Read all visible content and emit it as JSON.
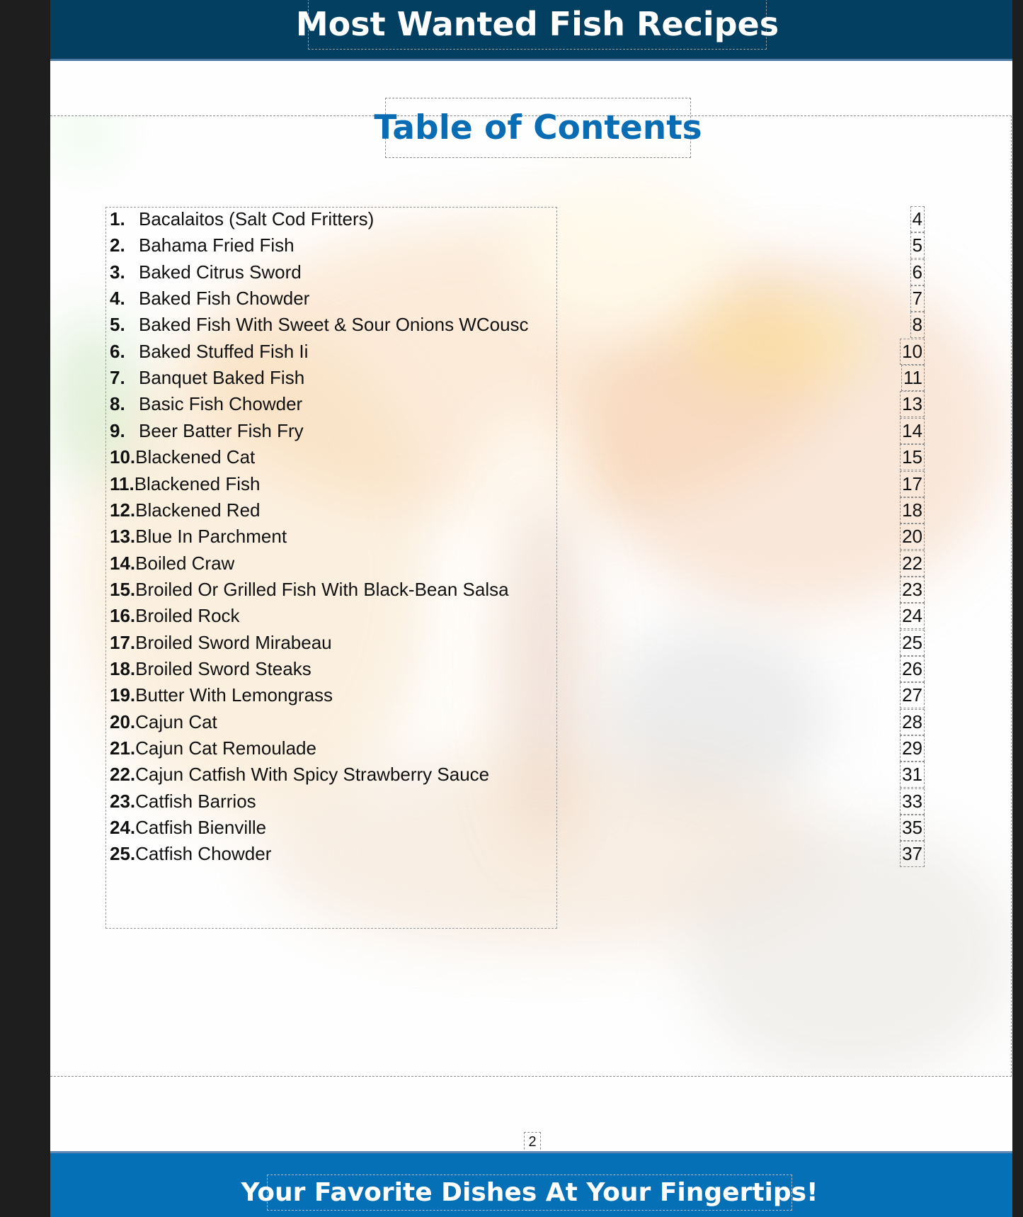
{
  "header": {
    "title": "Most Wanted Fish Recipes"
  },
  "toc": {
    "title": "Table of Contents",
    "entries": [
      {
        "number": "1.",
        "title": "Bacalaitos (Salt Cod Fritters)",
        "page": "4"
      },
      {
        "number": "2.",
        "title": "Bahama Fried Fish",
        "page": "5"
      },
      {
        "number": "3.",
        "title": "Baked Citrus Sword",
        "page": "6"
      },
      {
        "number": "4.",
        "title": "Baked Fish Chowder",
        "page": "7"
      },
      {
        "number": "5.",
        "title": "Baked Fish With Sweet & Sour Onions WCousc",
        "page": "8"
      },
      {
        "number": "6.",
        "title": "Baked Stuffed Fish Ii",
        "page": "10"
      },
      {
        "number": "7.",
        "title": "Banquet Baked Fish",
        "page": "11"
      },
      {
        "number": "8.",
        "title": "Basic Fish Chowder",
        "page": "13"
      },
      {
        "number": "9.",
        "title": "Beer Batter Fish Fry",
        "page": "14"
      },
      {
        "number": "10.",
        "title": "Blackened Cat",
        "page": "15"
      },
      {
        "number": "11.",
        "title": "Blackened Fish",
        "page": "17"
      },
      {
        "number": "12.",
        "title": "Blackened Red",
        "page": "18"
      },
      {
        "number": "13.",
        "title": "Blue In Parchment",
        "page": "20"
      },
      {
        "number": "14.",
        "title": "Boiled Craw",
        "page": "22"
      },
      {
        "number": "15.",
        "title": "Broiled Or Grilled Fish With Black-Bean Salsa",
        "page": "23"
      },
      {
        "number": "16.",
        "title": "Broiled Rock",
        "page": "24"
      },
      {
        "number": "17.",
        "title": "Broiled Sword Mirabeau",
        "page": "25"
      },
      {
        "number": "18.",
        "title": "Broiled Sword Steaks",
        "page": "26"
      },
      {
        "number": "19.",
        "title": "Butter With Lemongrass",
        "page": "27"
      },
      {
        "number": "20.",
        "title": "Cajun Cat",
        "page": "28"
      },
      {
        "number": "21.",
        "title": "Cajun Cat Remoulade",
        "page": "29"
      },
      {
        "number": "22.",
        "title": "Cajun Catfish With Spicy Strawberry Sauce",
        "page": "31"
      },
      {
        "number": "23.",
        "title": "Catfish Barrios",
        "page": "33"
      },
      {
        "number": "24.",
        "title": "Catfish Bienville",
        "page": "35"
      },
      {
        "number": "25.",
        "title": "Catfish Chowder",
        "page": "37"
      }
    ]
  },
  "page_number": "2",
  "footer": {
    "title": "Your Favorite Dishes At Your Fingertips!"
  },
  "colors": {
    "header_band": "#033f61",
    "toc_title": "#0a6cb3",
    "footer_band": "#0670b7"
  }
}
